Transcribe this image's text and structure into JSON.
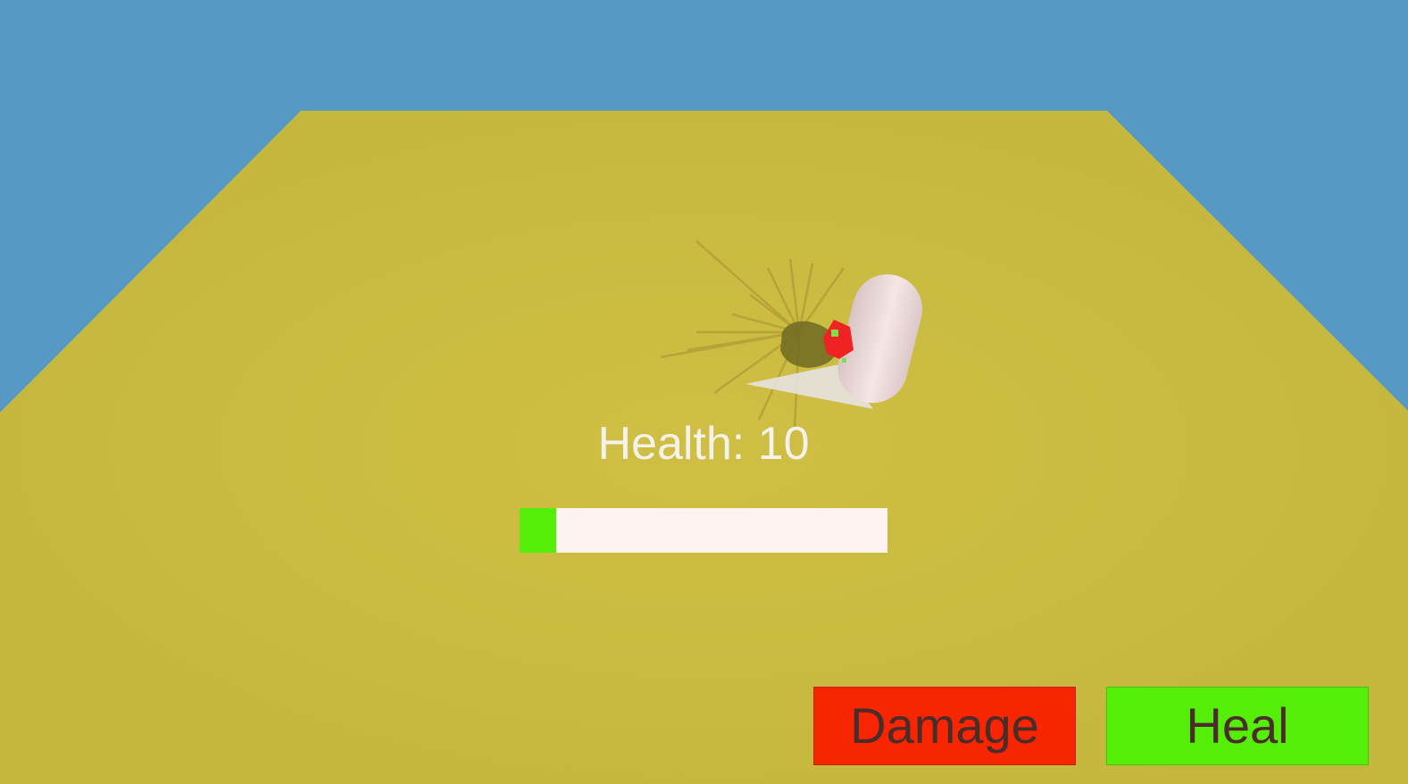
{
  "hud": {
    "health_text": "Health: 10",
    "health_fraction": 0.1,
    "health_fill_color": "#55ee08",
    "health_track_color": "#fdf3f1"
  },
  "buttons": {
    "damage_label": "Damage",
    "damage_color": "#f72500",
    "heal_label": "Heal",
    "heal_color": "#55ee08"
  },
  "scene_colors": {
    "sky": "#5599c4",
    "ground": "#cbbd40",
    "player": "#f1dcdc",
    "player_accent": "#f02222"
  }
}
